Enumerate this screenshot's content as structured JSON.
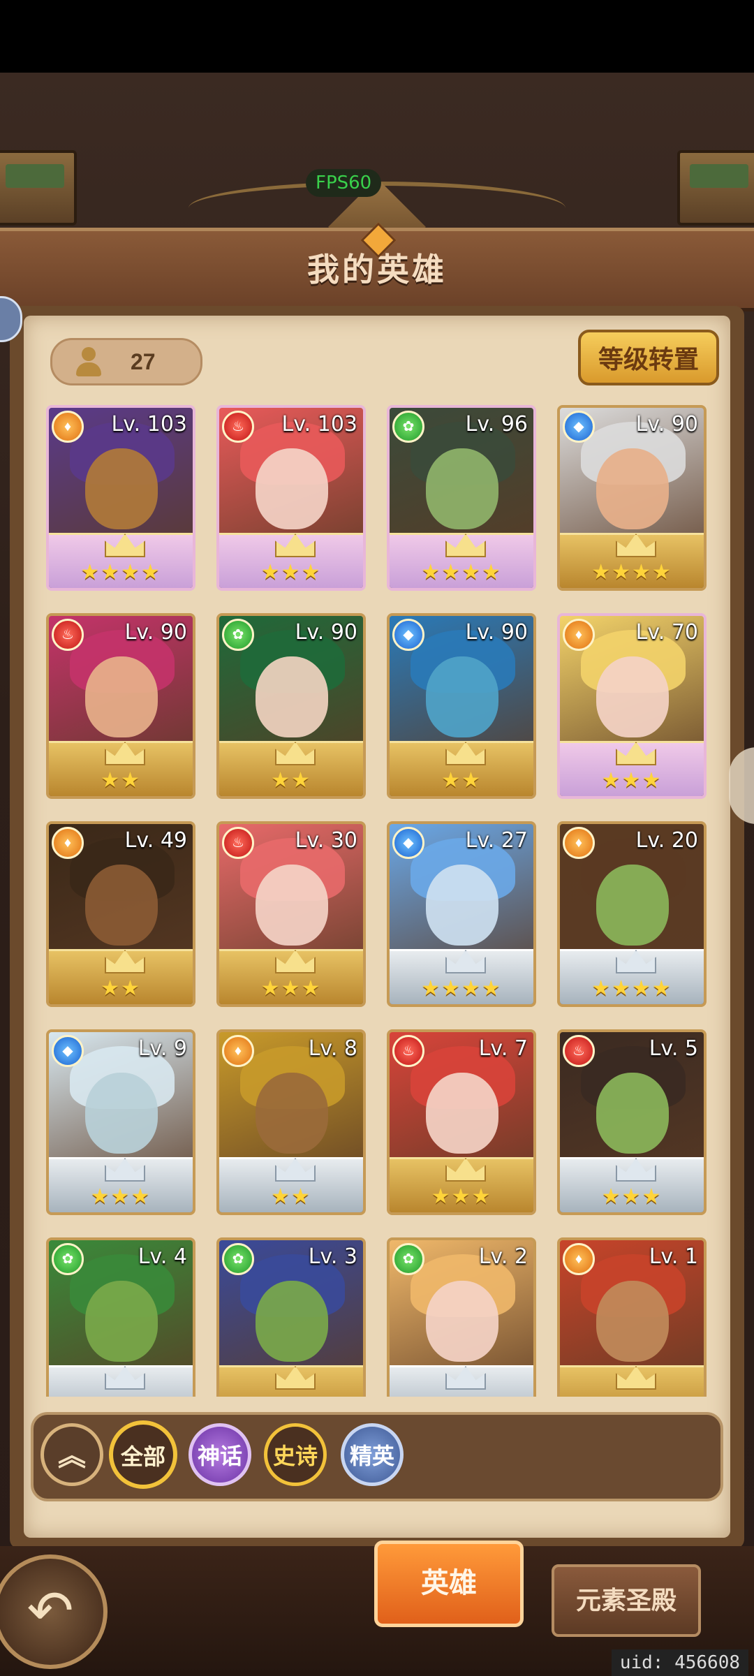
{
  "hud": {
    "fps": "FPS60"
  },
  "header": {
    "title": "我的英雄"
  },
  "hero_count": "27",
  "buttons": {
    "level_reset": "等级转置"
  },
  "heroes": [
    {
      "level": "Lv. 103",
      "element": "earth",
      "stars": "★★★★",
      "base": "pinkwing",
      "hair": "#5a3a8a",
      "face": "#b07a3a"
    },
    {
      "level": "Lv. 103",
      "element": "fire",
      "stars": "★★★",
      "base": "pinkwing",
      "hair": "#e85a5a",
      "face": "#f4d3c6"
    },
    {
      "level": "Lv. 96",
      "element": "wind",
      "stars": "★★★★",
      "base": "pinkwing",
      "hair": "#3b4a3a",
      "face": "#8fb36a"
    },
    {
      "level": "Lv. 90",
      "element": "water",
      "stars": "★★★★",
      "base": "gold",
      "hair": "#dcdcdc",
      "face": "#e7b08a"
    },
    {
      "level": "Lv. 90",
      "element": "fire",
      "stars": "★★",
      "base": "gold",
      "hair": "#c4336a",
      "face": "#e7b08a"
    },
    {
      "level": "Lv. 90",
      "element": "wind",
      "stars": "★★",
      "base": "gold",
      "hair": "#1f6a3a",
      "face": "#f1d2c0"
    },
    {
      "level": "Lv. 90",
      "element": "water",
      "stars": "★★",
      "base": "gold",
      "hair": "#2a7ab8",
      "face": "#4fa3c8"
    },
    {
      "level": "Lv. 70",
      "element": "earth",
      "stars": "★★★",
      "base": "pinkwing",
      "hair": "#f3d36a",
      "face": "#f4d3c6"
    },
    {
      "level": "Lv. 49",
      "element": "earth",
      "stars": "★★",
      "base": "gold",
      "hair": "#3a2818",
      "face": "#8a5a34"
    },
    {
      "level": "Lv. 30",
      "element": "fire",
      "stars": "★★★",
      "base": "gold",
      "hair": "#e86a6a",
      "face": "#f4d3c6"
    },
    {
      "level": "Lv. 27",
      "element": "water",
      "stars": "★★★★",
      "base": "white",
      "hair": "#6aa8e8",
      "face": "#cde0f0"
    },
    {
      "level": "Lv. 20",
      "element": "earth",
      "stars": "★★★★",
      "base": "white",
      "hair": "#5a3a22",
      "face": "#8ab55a"
    },
    {
      "level": "Lv. 9",
      "element": "water",
      "stars": "★★★",
      "base": "white",
      "hair": "#d8e8f0",
      "face": "#b8d0d8"
    },
    {
      "level": "Lv. 8",
      "element": "earth",
      "stars": "★★",
      "base": "white",
      "hair": "#c89a2a",
      "face": "#9a6a3a"
    },
    {
      "level": "Lv. 7",
      "element": "fire",
      "stars": "★★★",
      "base": "gold",
      "hair": "#d8443a",
      "face": "#f4d3c6"
    },
    {
      "level": "Lv. 5",
      "element": "fire",
      "stars": "★★★",
      "base": "white",
      "hair": "#3a2a22",
      "face": "#8ab55a"
    },
    {
      "level": "Lv. 4",
      "element": "wind",
      "stars": "",
      "base": "white",
      "hair": "#3a8a3a",
      "face": "#7aa84a"
    },
    {
      "level": "Lv. 3",
      "element": "wind",
      "stars": "",
      "base": "gold",
      "hair": "#3a4a9a",
      "face": "#7aa84a"
    },
    {
      "level": "Lv. 2",
      "element": "wind",
      "stars": "",
      "base": "white",
      "hair": "#f0b86a",
      "face": "#f4d3c6"
    },
    {
      "level": "Lv. 1",
      "element": "earth",
      "stars": "",
      "base": "gold",
      "hair": "#c8442a",
      "face": "#c08a5a"
    }
  ],
  "filters": {
    "all": "全部",
    "myth": "神话",
    "epic": "史诗",
    "elite": "精英"
  },
  "tabs": {
    "hero": "英雄",
    "temple": "元素圣殿"
  },
  "uid": "uid: 456608",
  "colors": {
    "fire": "#c01414",
    "earth": "#e07010",
    "water": "#1a62d0",
    "wind": "#1e9a2a"
  }
}
